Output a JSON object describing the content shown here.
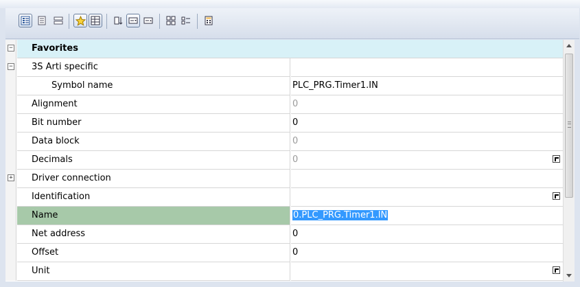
{
  "toolbar": {
    "buttons": [
      {
        "icon": "categorized-view-icon",
        "pressed": true
      },
      {
        "icon": "property-pages-icon",
        "pressed": false
      },
      {
        "icon": "list-view-icon",
        "pressed": false
      },
      {
        "icon": "favorites-star-icon",
        "pressed": true
      },
      {
        "icon": "property-sheet-icon",
        "pressed": true
      },
      {
        "icon": "sort-icon",
        "pressed": false
      },
      {
        "icon": "edit-field-icon",
        "pressed": true
      },
      {
        "icon": "dropdown-field-icon",
        "pressed": false
      },
      {
        "icon": "expand-all-icon",
        "pressed": false
      },
      {
        "icon": "collapse-all-icon",
        "pressed": false
      },
      {
        "icon": "calculator-icon",
        "pressed": false
      }
    ]
  },
  "grid": {
    "favorites_label": "Favorites",
    "rows": [
      {
        "name": "3S Arti specific",
        "value": "",
        "expander": "−"
      },
      {
        "name": "Symbol name",
        "value": "PLC_PRG.Timer1.IN"
      },
      {
        "name": "Alignment",
        "value": "0"
      },
      {
        "name": "Bit number",
        "value": "0"
      },
      {
        "name": "Data block",
        "value": "0"
      },
      {
        "name": "Decimals",
        "value": "0"
      },
      {
        "name": "Driver connection",
        "value": "",
        "expander": "+"
      },
      {
        "name": "Identification",
        "value": ""
      },
      {
        "name": "Name",
        "value": "0.PLC_PRG.Timer1.IN"
      },
      {
        "name": "Net address",
        "value": "0"
      },
      {
        "name": "Offset",
        "value": "0"
      },
      {
        "name": "Unit",
        "value": ""
      }
    ]
  },
  "colors": {
    "favorites_header_bg": "#d8f1f7",
    "selected_name_bg": "#a7c9a9",
    "selection_highlight": "#3399ff",
    "disabled_text": "#9a9a9a"
  }
}
